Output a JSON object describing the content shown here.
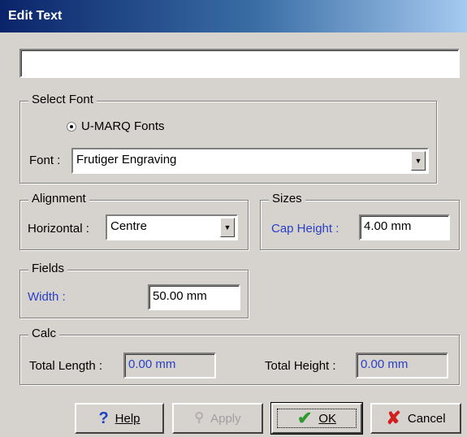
{
  "window": {
    "title": "Edit Text"
  },
  "text_field": {
    "value": ""
  },
  "select_font": {
    "legend": "Select Font",
    "radio_label": "U-MARQ Fonts",
    "font_label": "Font :",
    "font_value": "Frutiger Engraving"
  },
  "alignment": {
    "legend": "Alignment",
    "horizontal_label": "Horizontal :",
    "horizontal_value": "Centre"
  },
  "sizes": {
    "legend": "Sizes",
    "cap_height_label": "Cap Height :",
    "cap_height_value": "4.00 mm"
  },
  "fields": {
    "legend": "Fields",
    "width_label": "Width :",
    "width_value": "50.00 mm"
  },
  "calc": {
    "legend": "Calc",
    "total_length_label": "Total Length :",
    "total_length_value": "0.00 mm",
    "total_height_label": "Total Height :",
    "total_height_value": "0.00 mm"
  },
  "buttons": {
    "help": {
      "label": "Help",
      "icon": "question-icon"
    },
    "apply": {
      "label": "Apply",
      "icon": "apply-icon"
    },
    "ok": {
      "label": "OK",
      "icon": "checkmark-icon"
    },
    "cancel": {
      "label": "Cancel",
      "icon": "x-icon"
    }
  },
  "colors": {
    "title_bar": "#0a246a",
    "link_label": "#2a3ec8",
    "ok_check": "#2e9a2e",
    "cancel_x": "#d02020",
    "help_q": "#1a40c0"
  }
}
